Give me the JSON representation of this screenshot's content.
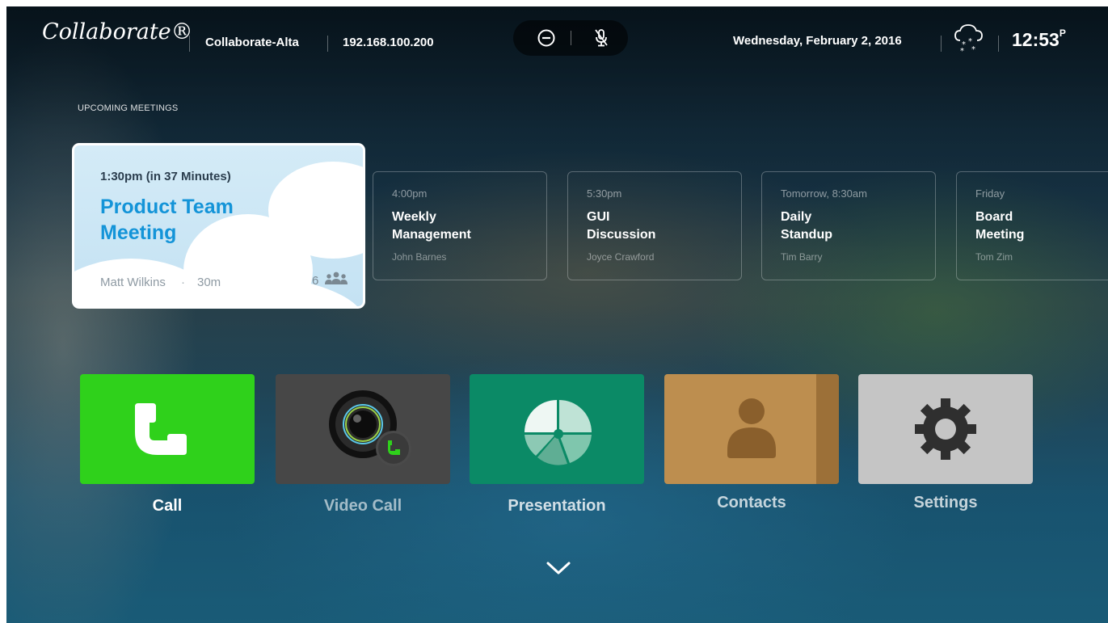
{
  "header": {
    "logo": "Collaborate®",
    "hostname": "Collaborate-Alta",
    "ip": "192.168.100.200",
    "date": "Wednesday, February 2, 2016",
    "time": "12:53",
    "time_suffix": "P",
    "weather_icon": "snow-cloud-icon",
    "controls": [
      "do-not-disturb-icon",
      "mute-microphone-icon"
    ]
  },
  "meetings": {
    "section_label": "UPCOMING MEETINGS",
    "featured": {
      "time": "1:30pm (in 37 Minutes)",
      "title": "Product Team Meeting",
      "host": "Matt Wilkins",
      "separator": "·",
      "duration": "30m",
      "attendees": "6"
    },
    "items": [
      {
        "time": "4:00pm",
        "title": "Weekly Management",
        "host": "John Barnes"
      },
      {
        "time": "5:30pm",
        "title": "GUI Discussion",
        "host": "Joyce Crawford"
      },
      {
        "time": "Tomorrow, 8:30am",
        "title": "Daily Standup",
        "host": "Tim Barry"
      },
      {
        "time": "Friday",
        "title": "Board Meeting",
        "host": "Tom Zim"
      }
    ]
  },
  "apps": [
    {
      "label": "Call",
      "icon": "phone-icon",
      "color": "#2fd11b"
    },
    {
      "label": "Video Call",
      "icon": "camera-icon",
      "color": "#474747"
    },
    {
      "label": "Presentation",
      "icon": "pie-chart-icon",
      "color": "#0b8a66"
    },
    {
      "label": "Contacts",
      "icon": "contact-book-icon",
      "color": "#bd8e4f"
    },
    {
      "label": "Settings",
      "icon": "gear-icon",
      "color": "#c5c5c5"
    }
  ],
  "footer": {
    "more_icon": "chevron-down-icon"
  }
}
